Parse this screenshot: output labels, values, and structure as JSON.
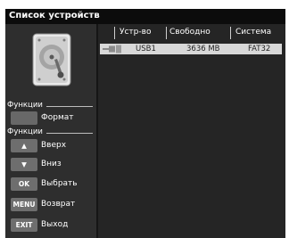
{
  "window": {
    "title": "Список устройств"
  },
  "device_icon": "hard-drive-icon",
  "functions_label": "Функции",
  "format_button": {
    "label": "Формат"
  },
  "navigation_label": "Функции",
  "nav_items": [
    {
      "key_icon": "triangle-up-icon",
      "key": "▲",
      "label": "Вверх"
    },
    {
      "key_icon": "triangle-down-icon",
      "key": "▼",
      "label": "Вниз"
    },
    {
      "key": "OK",
      "label": "Выбрать"
    },
    {
      "key": "MENU",
      "label": "Возврат"
    },
    {
      "key": "EXIT",
      "label": "Выход"
    }
  ],
  "table": {
    "columns": [
      "Устр-во",
      "Свободно",
      "Система"
    ],
    "rows": [
      {
        "icon": "usb-icon",
        "device": "USB1",
        "free": "3636 MB",
        "system": "FAT32"
      }
    ]
  },
  "colors": {
    "panel": "#2e2e2e",
    "titlebar": "#0c0c0c",
    "list": "#252525",
    "selected_row": "#d8d8d8",
    "key": "#6e6e6e"
  }
}
